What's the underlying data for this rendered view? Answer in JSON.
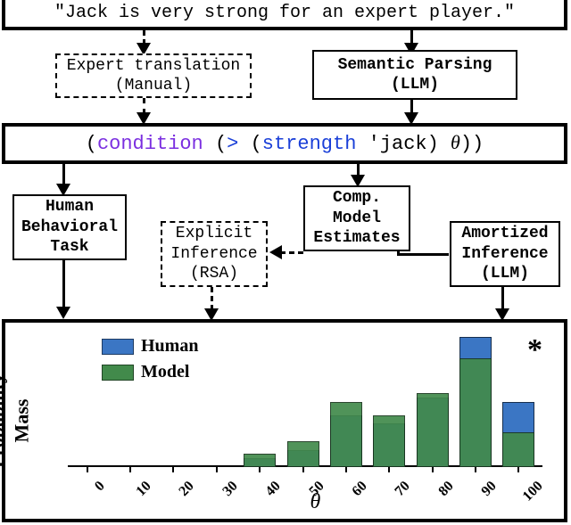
{
  "input": {
    "sentence": "\"Jack is very strong for an expert player.\""
  },
  "translation": {
    "expert": {
      "line1": "Expert translation",
      "line2": "(Manual)"
    },
    "semantic": {
      "line1": "Semantic Parsing",
      "line2": "(LLM)"
    }
  },
  "code": {
    "paren_open": "(",
    "condition": "condition",
    "paren_open2": " (",
    "gt": ">",
    "paren_open3": " (",
    "strength": "strength",
    "arg": " 'jack",
    "paren_close1": ") ",
    "theta": "θ",
    "paren_close2": "))"
  },
  "mid_boxes": {
    "human_task": {
      "line1": "Human",
      "line2": "Behavioral",
      "line3": "Task"
    },
    "explicit": {
      "line1": "Explicit",
      "line2": "Inference",
      "line3": "(RSA)"
    },
    "comp_model": {
      "line1": "Comp.",
      "line2": "Model",
      "line3": "Estimates"
    },
    "amortized": {
      "line1": "Amortized",
      "line2": "Inference",
      "line3": "(LLM)"
    }
  },
  "chart_data": {
    "type": "bar",
    "categories": [
      "0",
      "10",
      "20",
      "30",
      "40",
      "50",
      "60",
      "70",
      "80",
      "90",
      "100"
    ],
    "series": [
      {
        "name": "Human",
        "values": [
          0,
          0,
          0,
          0,
          0.02,
          0.04,
          0.12,
          0.1,
          0.16,
          0.3,
          0.15
        ]
      },
      {
        "name": "Model",
        "values": [
          0,
          0,
          0,
          0,
          0.03,
          0.06,
          0.15,
          0.12,
          0.17,
          0.25,
          0.08
        ]
      }
    ],
    "ylabel": "Probability\nMass",
    "xlabel": "θ",
    "ylim": [
      0,
      0.3
    ],
    "legend": {
      "human": "Human",
      "model": "Model"
    },
    "annotation": "*"
  }
}
